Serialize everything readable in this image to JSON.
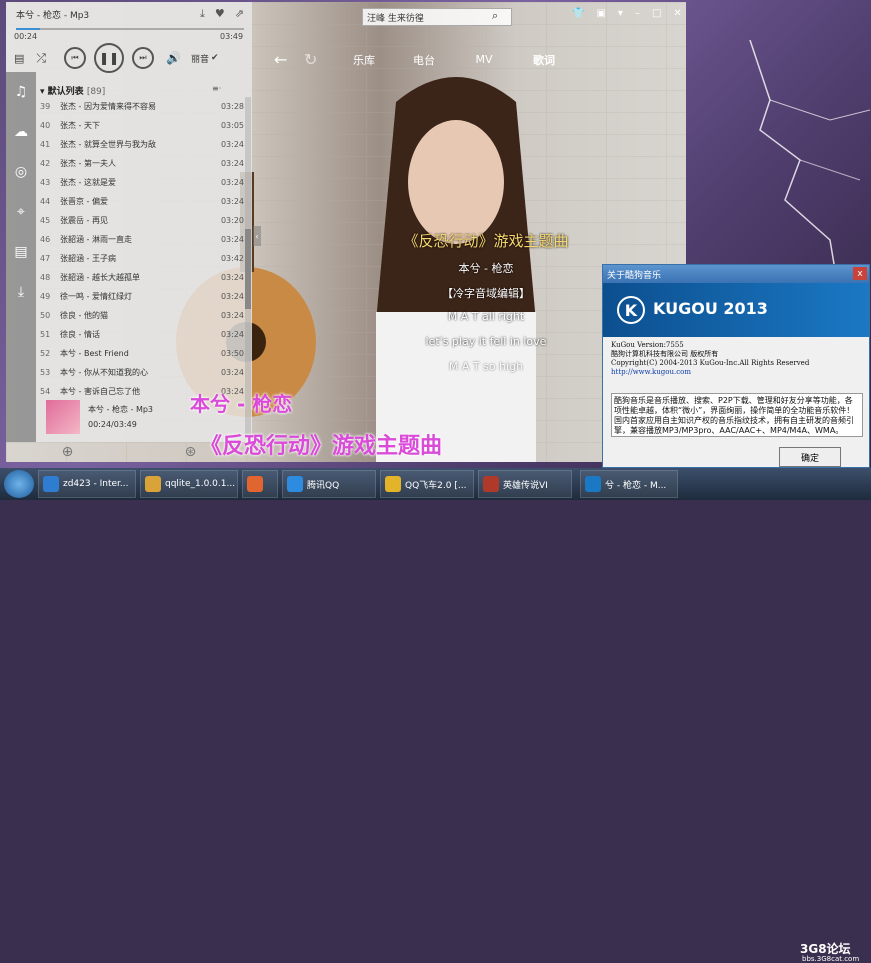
{
  "player": {
    "song_title": "本兮 - 枪恋 - Mp3",
    "time_elapsed": "00:24",
    "time_total": "03:49",
    "progress": 0.105,
    "quality_label": "丽音",
    "search_value": "汪峰 生来彷徨",
    "tabs": [
      "乐库",
      "电台",
      "MV",
      "歌词"
    ],
    "playlist_name": "默认列表",
    "playlist_count": "[89]",
    "songs": [
      {
        "n": "39",
        "t": "张杰 - 因为爱情来得不容易",
        "d": "03:28"
      },
      {
        "n": "40",
        "t": "张杰 - 天下",
        "d": "03:05"
      },
      {
        "n": "41",
        "t": "张杰 - 就算全世界与我为敌",
        "d": "03:24"
      },
      {
        "n": "42",
        "t": "张杰 - 第一夫人",
        "d": "03:24"
      },
      {
        "n": "43",
        "t": "张杰 - 这就是爱",
        "d": "03:24"
      },
      {
        "n": "44",
        "t": "张晋京 - 偏爱",
        "d": "03:24"
      },
      {
        "n": "45",
        "t": "张震岳 - 再见",
        "d": "03:20"
      },
      {
        "n": "46",
        "t": "张韶涵 - 淋雨一直走",
        "d": "03:24"
      },
      {
        "n": "47",
        "t": "张韶涵 - 王子病",
        "d": "03:42"
      },
      {
        "n": "48",
        "t": "张韶涵 - 越长大越孤单",
        "d": "03:24"
      },
      {
        "n": "49",
        "t": "徐一鸣 - 爱情红绿灯",
        "d": "03:24"
      },
      {
        "n": "50",
        "t": "徐良 - 他的猫",
        "d": "03:24"
      },
      {
        "n": "51",
        "t": "徐良 - 情话",
        "d": "03:24"
      },
      {
        "n": "52",
        "t": "本兮 - Best Friend",
        "d": "03:50"
      },
      {
        "n": "53",
        "t": "本兮 - 你从不知道我的心",
        "d": "03:24"
      },
      {
        "n": "54",
        "t": "本兮 - 害诉自己忘了他",
        "d": "03:24"
      }
    ],
    "now_title": "本兮 - 枪恋 - Mp3",
    "now_time": "00:24/03:49",
    "lyrics": [
      "《反恐行动》游戏主题曲",
      "本兮 - 枪恋",
      "【冷字音域编辑】",
      "M A T all right",
      "let's play it fell in love",
      "M A T so high"
    ]
  },
  "desktop_lyric": {
    "line1": "本兮 - 枪恋",
    "line2": "《反恐行动》游戏主题曲"
  },
  "about": {
    "title": "关于酷狗音乐",
    "close": "x",
    "logo_letter": "K",
    "logo_text": "KUGOU 2013",
    "version": "KuGou Version:7555",
    "company": "酷狗计算机科技有限公司 版权所有",
    "copyright": "Copyright(C) 2004-2013 KuGou-Inc.All Rights Reserved",
    "url": "http://www.kugou.com",
    "desc": "酷狗音乐是音乐播放、搜索、P2P下载、管理和好友分享等功能，各项性能卓越，体积“微小”，界面绚丽，操作简单的全功能音乐软件！ 国内首家应用自主知识产权的音乐指纹技术，拥有自主研发的音频引擎，兼容播放MP3/MP3pro、AAC/AAC+、MP4/M4A、WMA。",
    "ok": "确定"
  },
  "taskbar": {
    "items": [
      {
        "label": "zd423 - Inter...",
        "color": "#2f7dd0"
      },
      {
        "label": "qqlite_1.0.0.1...",
        "color": "#d9a33a"
      },
      {
        "label": "",
        "color": "#e0652f"
      },
      {
        "label": "腾讯QQ",
        "color": "#2d8be0"
      },
      {
        "label": "QQ飞车2.0 [...",
        "color": "#e3b42a"
      },
      {
        "label": "英雄传说VI",
        "color": "#b03a2a"
      },
      {
        "label": "兮 - 枪恋 - M...",
        "color": "#1b78c4"
      }
    ],
    "watermark": "3G8论坛",
    "watermark_sub": "bbs.3G8cat.com"
  }
}
